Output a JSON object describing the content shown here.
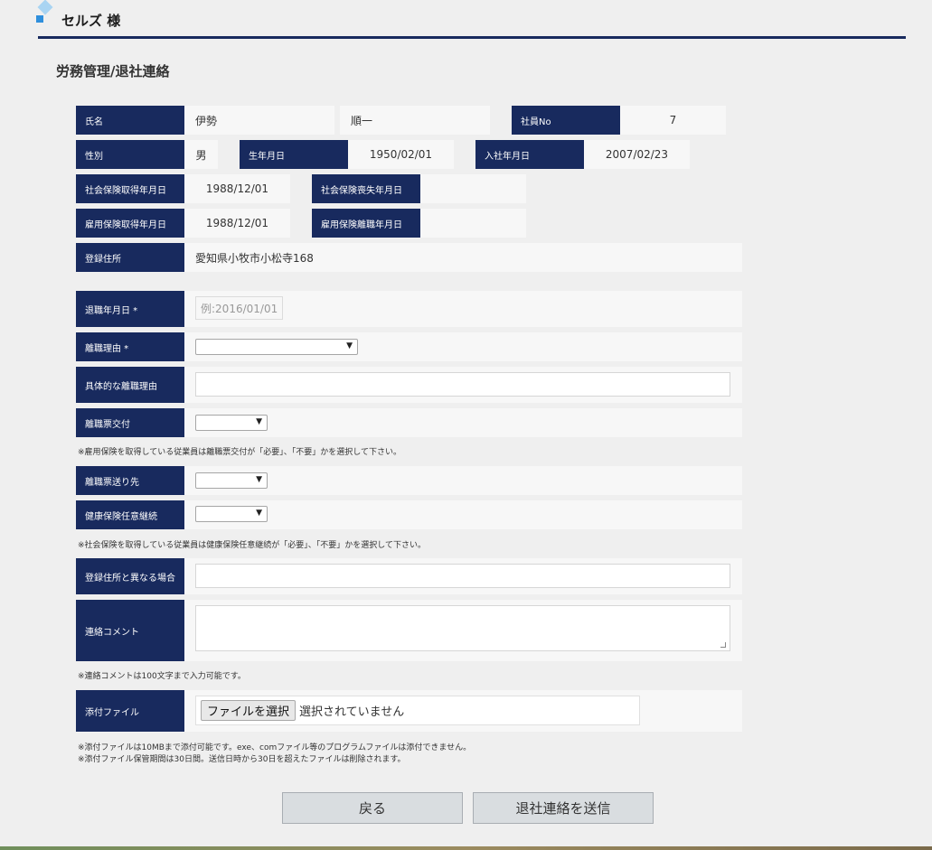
{
  "header": {
    "user_name": "セルズ 様"
  },
  "page_title": "労務管理/退社連絡",
  "employee": {
    "name_label": "氏名",
    "last_name": "伊勢",
    "first_name": "順一",
    "employee_no_label": "社員No",
    "employee_no": "7",
    "gender_label": "性別",
    "gender": "男",
    "birth_label": "生年月日",
    "birth": "1950/02/01",
    "join_label": "入社年月日",
    "join": "2007/02/23",
    "social_get_label": "社会保険取得年月日",
    "social_get": "1988/12/01",
    "social_loss_label": "社会保険喪失年月日",
    "social_loss": "",
    "employ_get_label": "雇用保険取得年月日",
    "employ_get": "1988/12/01",
    "employ_leave_label": "雇用保険離職年月日",
    "employ_leave": "",
    "address_label": "登録住所",
    "address": "愛知県小牧市小松寺168"
  },
  "form": {
    "retire_date_label": "退職年月日 *",
    "retire_date_placeholder": "例:2016/01/01",
    "reason_label": "離職理由 *",
    "reason_detail_label": "具体的な離職理由",
    "slip_issue_label": "離職票交付",
    "note_slip": "※雇用保険を取得している従業員は離職票交付が「必要」、「不要」かを選択して下さい。",
    "slip_dest_label": "離職票送り先",
    "health_label": "健康保険任意継続",
    "note_health": "※社会保険を取得している従業員は健康保険任意継続が「必要」、「不要」かを選択して下さい。",
    "diff_address_label": "登録住所と異なる場合",
    "comment_label": "連絡コメント",
    "note_comment": "※連絡コメントは100文字まで入力可能です。",
    "file_label": "添付ファイル",
    "file_button": "ファイルを選択",
    "file_status": "選択されていません",
    "note_file1": "※添付ファイルは10MBまで添付可能です。exe、comファイル等のプログラムファイルは添付できません。",
    "note_file2": "※添付ファイル保管期間は30日間。送信日時から30日を超えたファイルは削除されます。"
  },
  "buttons": {
    "back": "戻る",
    "submit": "退社連絡を送信"
  },
  "icons": {
    "select_arrow": "▼"
  }
}
